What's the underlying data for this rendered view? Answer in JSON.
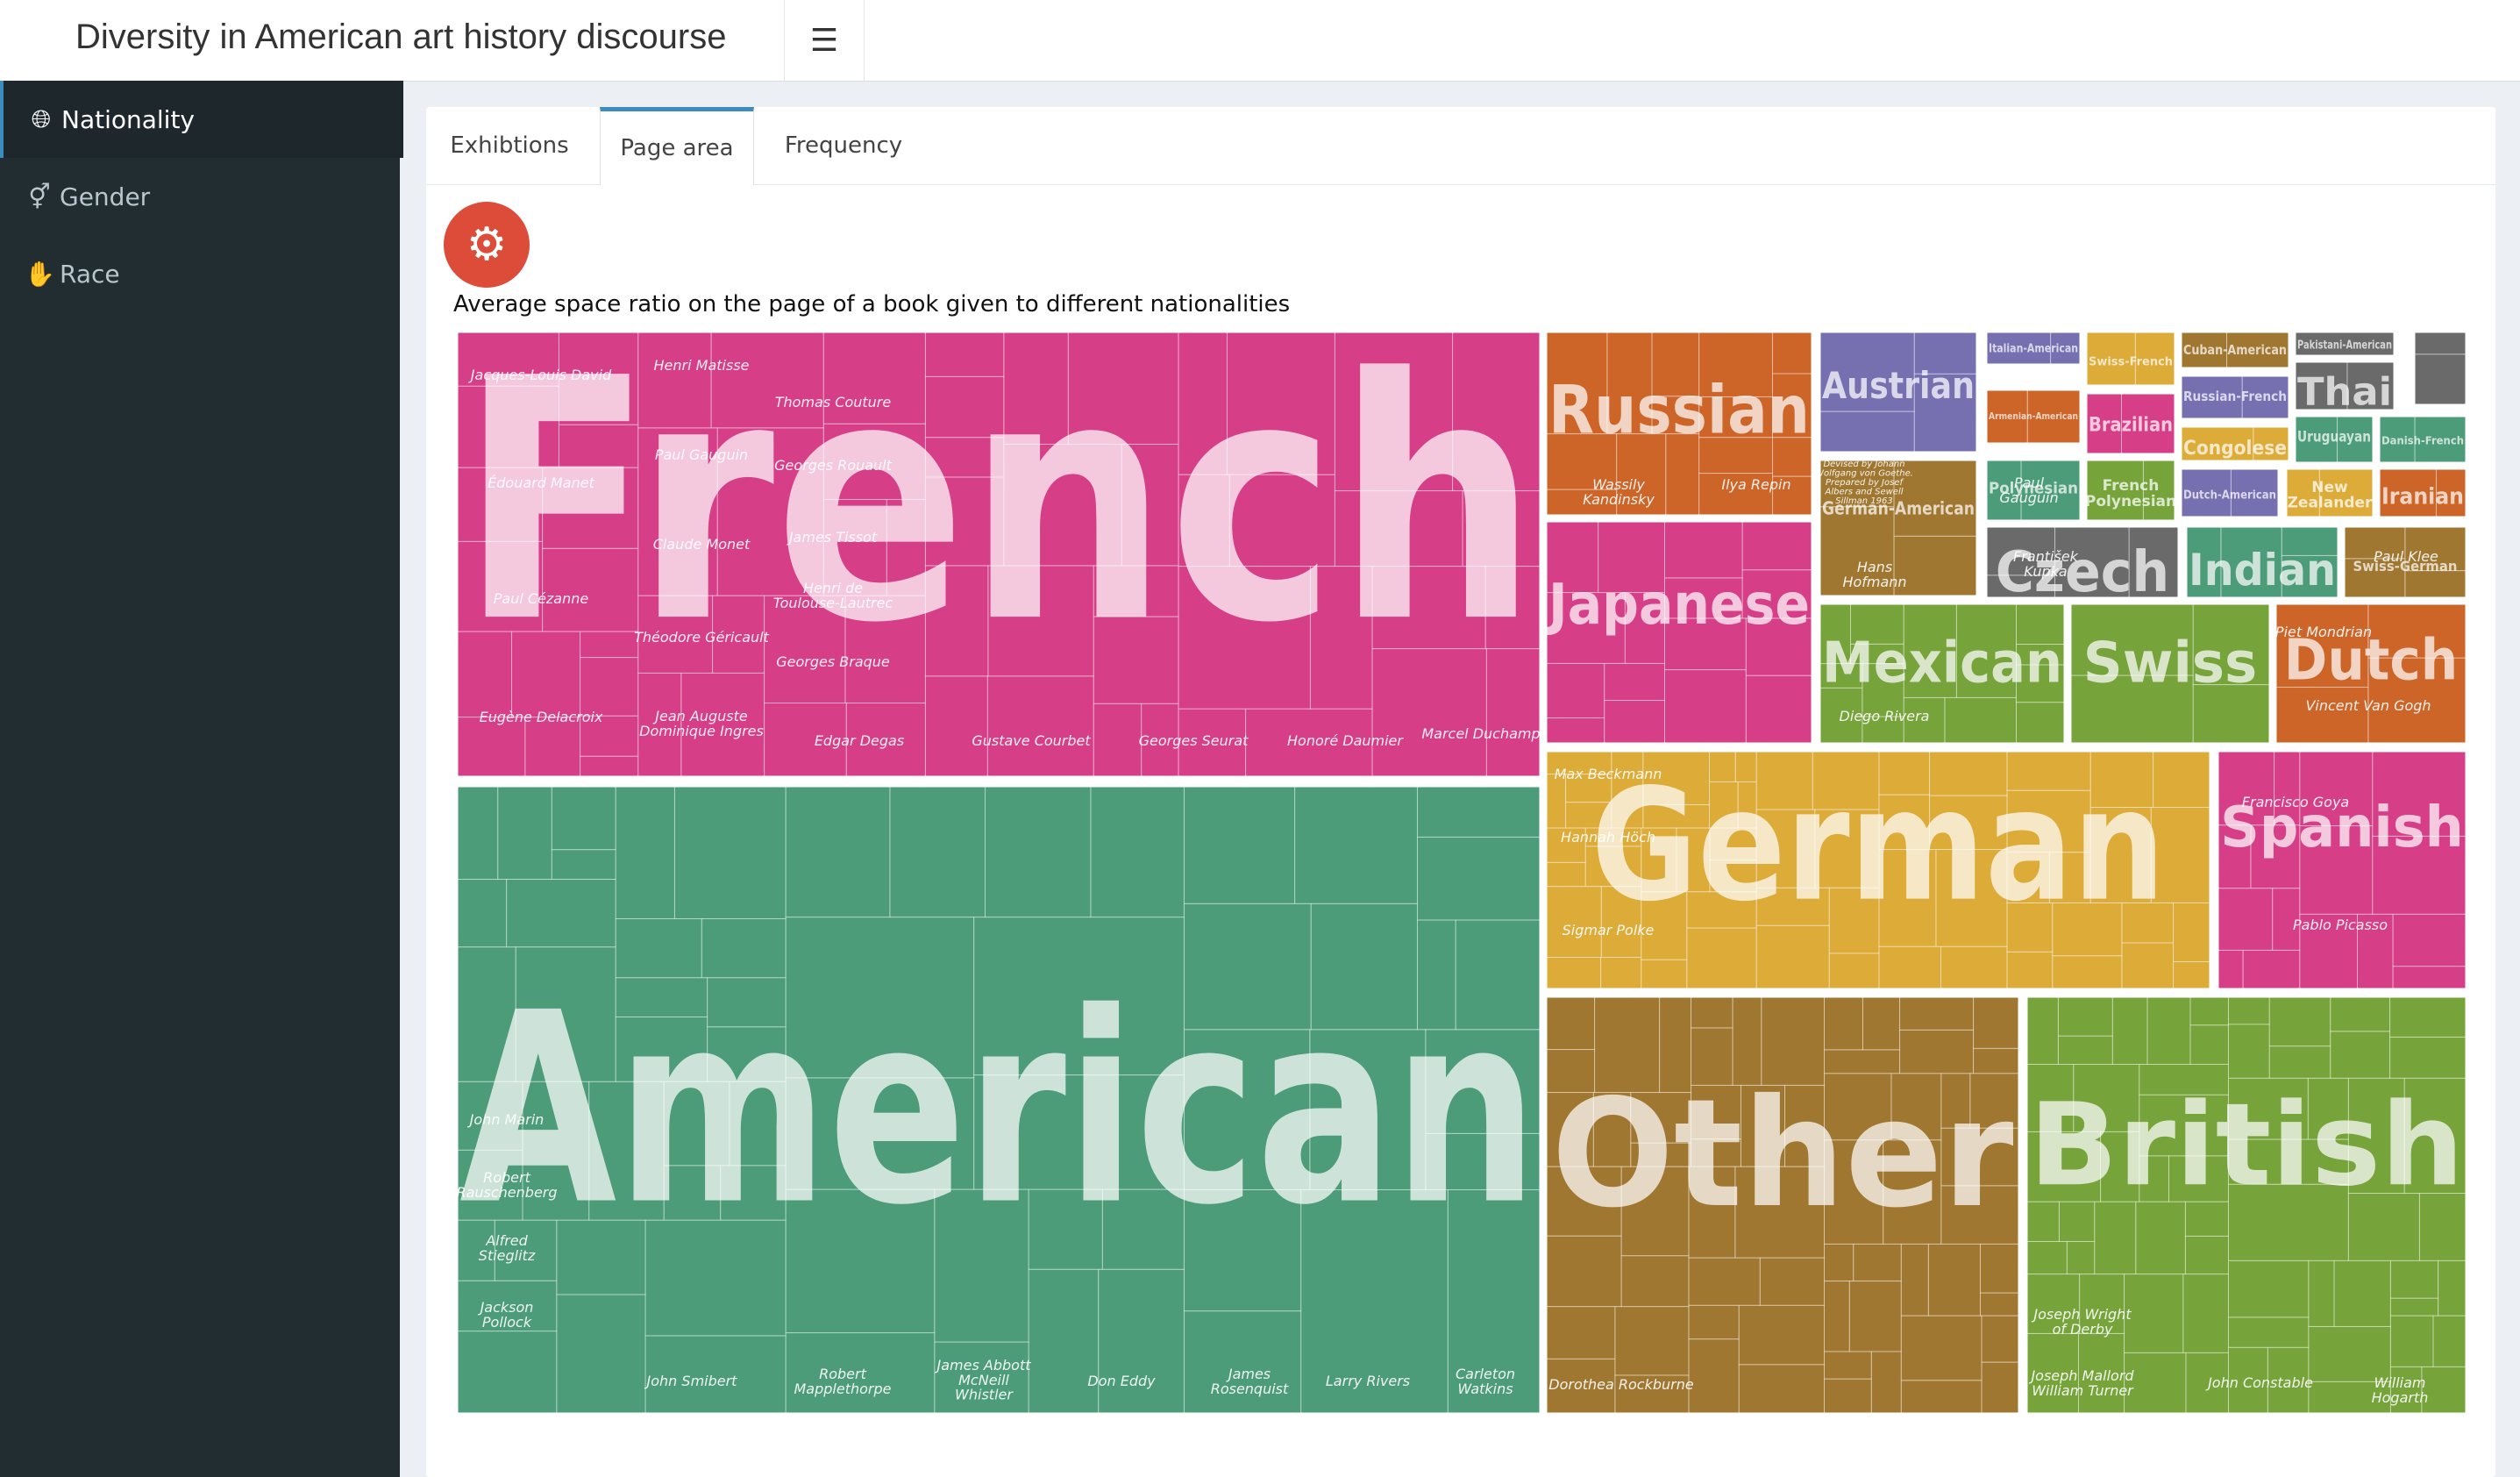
{
  "app": {
    "title": "Diversity in American art history discourse"
  },
  "header": {
    "menu_icon": "hamburger-icon"
  },
  "sidebar": {
    "items": [
      {
        "label": "Nationality",
        "icon": "globe-icon",
        "active": true
      },
      {
        "label": "Gender",
        "icon": "gender-icon",
        "active": false
      },
      {
        "label": "Race",
        "icon": "hands-icon",
        "active": false
      }
    ]
  },
  "tabs": [
    {
      "label": "Exhibtions",
      "active": false
    },
    {
      "label": "Page area",
      "active": true
    },
    {
      "label": "Frequency",
      "active": false
    }
  ],
  "controls": {
    "settings_icon": "gear-icon",
    "button_color": "#dd4b39"
  },
  "chart_data": {
    "type": "treemap",
    "title": "Average space ratio on the page of a book given to different nationalities",
    "groups": [
      {
        "name": "French",
        "color": "#d63f88",
        "artists": [
          "Jacques-Louis David",
          "Édouard Manet",
          "Paul Cézanne",
          "Eugène Delacroix",
          "Henri Matisse",
          "Paul Gauguin",
          "Claude Monet",
          "Théodore Géricault",
          "Jean Auguste Dominique Ingres",
          "Thomas Couture",
          "Georges Rouault",
          "James Tissot",
          "Henri de Toulouse-Lautrec",
          "Georges Braque",
          "Edgar Degas",
          "Gustave Courbet",
          "Georges Seurat",
          "Honoré Daumier",
          "Marcel Duchamp"
        ]
      },
      {
        "name": "American",
        "color": "#4c9c79",
        "artists": [
          "John Marin",
          "Robert Rauschenberg",
          "Alfred Stieglitz",
          "Jackson Pollock",
          "John Smibert",
          "Robert Mapplethorpe",
          "James Abbott McNeill Whistler",
          "Don Eddy",
          "James Rosenquist",
          "Larry Rivers",
          "Carleton Watkins"
        ]
      },
      {
        "name": "Russian",
        "color": "#cd6428",
        "artists": [
          "Wassily Kandinsky",
          "Ilya Repin"
        ]
      },
      {
        "name": "Japanese",
        "color": "#d63f88",
        "artists": []
      },
      {
        "name": "German",
        "color": "#ddab38",
        "artists": [
          "Max Beckmann",
          "Hannah Höch",
          "Sigmar Polke"
        ]
      },
      {
        "name": "Other",
        "color": "#a07730",
        "artists": [
          "Dorothea Rockburne"
        ]
      },
      {
        "name": "British",
        "color": "#76a33a",
        "artists": [
          "Joseph Wright of Derby",
          "Joseph Mallord William Turner",
          "John Constable",
          "William Hogarth"
        ]
      },
      {
        "name": "Spanish",
        "color": "#d63f88",
        "artists": [
          "Francisco Goya",
          "Pablo Picasso"
        ]
      },
      {
        "name": "Austrian",
        "color": "#7670b1",
        "artists": []
      },
      {
        "name": "German-American",
        "color": "#a07730",
        "artists": [
          "Devised by Johann Wolfgang von Goethe. Prepared by Josef Albers and Sewell Sillman 1963",
          "Hans Hofmann"
        ]
      },
      {
        "name": "Mexican",
        "color": "#76a33a",
        "artists": [
          "Diego Rivera"
        ]
      },
      {
        "name": "Swiss",
        "color": "#76a33a",
        "artists": []
      },
      {
        "name": "Dutch",
        "color": "#cd6428",
        "artists": [
          "Piet Mondrian",
          "Vincent Van Gogh"
        ]
      },
      {
        "name": "Czech",
        "color": "#6a6a6a",
        "artists": [
          "František Kupka"
        ]
      },
      {
        "name": "Indian",
        "color": "#4c9c79",
        "artists": []
      },
      {
        "name": "Swiss-German",
        "color": "#a07730",
        "artists": [
          "Paul Klee"
        ]
      },
      {
        "name": "Polynesian",
        "color": "#4c9c79",
        "artists": [
          "Paul Gauguin"
        ]
      },
      {
        "name": "French Polynesian",
        "color": "#76a33a",
        "artists": []
      },
      {
        "name": "Dutch-American",
        "color": "#7670b1",
        "artists": []
      },
      {
        "name": "New Zealander",
        "color": "#ddab38",
        "artists": []
      },
      {
        "name": "Iranian",
        "color": "#cd6428",
        "artists": []
      },
      {
        "name": "Thai",
        "color": "#6a6a6a",
        "artists": []
      },
      {
        "name": "Brazilian",
        "color": "#d63f88",
        "artists": []
      },
      {
        "name": "Congolese",
        "color": "#ddab38",
        "artists": []
      },
      {
        "name": "Uruguayan",
        "color": "#4c9c79",
        "artists": []
      },
      {
        "name": "Danish-French",
        "color": "#4c9c79",
        "artists": []
      },
      {
        "name": "Italian-American",
        "color": "#7670b1",
        "artists": []
      },
      {
        "name": "Swiss-French",
        "color": "#ddab38",
        "artists": []
      },
      {
        "name": "Cuban-American",
        "color": "#a07730",
        "artists": []
      },
      {
        "name": "Pakistani-American",
        "color": "#6a6a6a",
        "artists": []
      },
      {
        "name": "Russian-French",
        "color": "#7670b1",
        "artists": []
      },
      {
        "name": "Armenian-American",
        "color": "#cd6428",
        "artists": []
      },
      {
        "name": "",
        "color": "#6a6a6a",
        "artists": []
      }
    ]
  }
}
